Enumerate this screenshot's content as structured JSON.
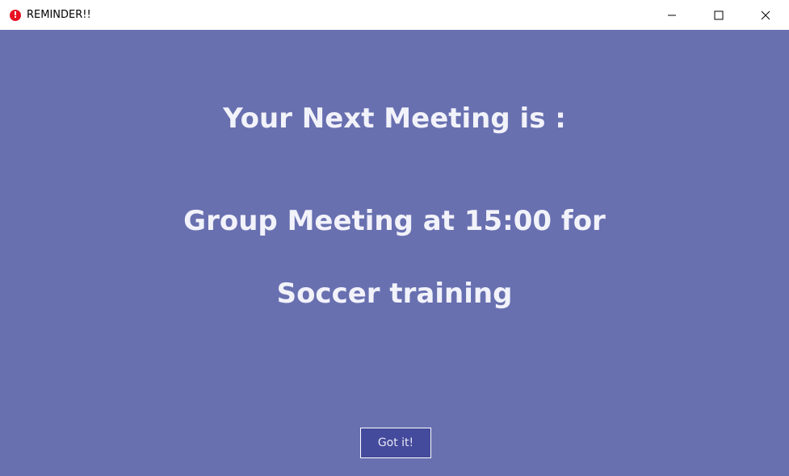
{
  "window": {
    "title": "REMINDER!!",
    "icon": "alert-icon",
    "background_color": "#6870b0"
  },
  "titlebar_controls": {
    "minimize": "minimize-icon",
    "maximize": "maximize-icon",
    "close": "close-icon"
  },
  "main": {
    "heading": "Your Next Meeting is :",
    "meeting_line": "Group Meeting at 15:00 for",
    "meeting_purpose": "Soccer training",
    "button_label": "Got it!"
  }
}
